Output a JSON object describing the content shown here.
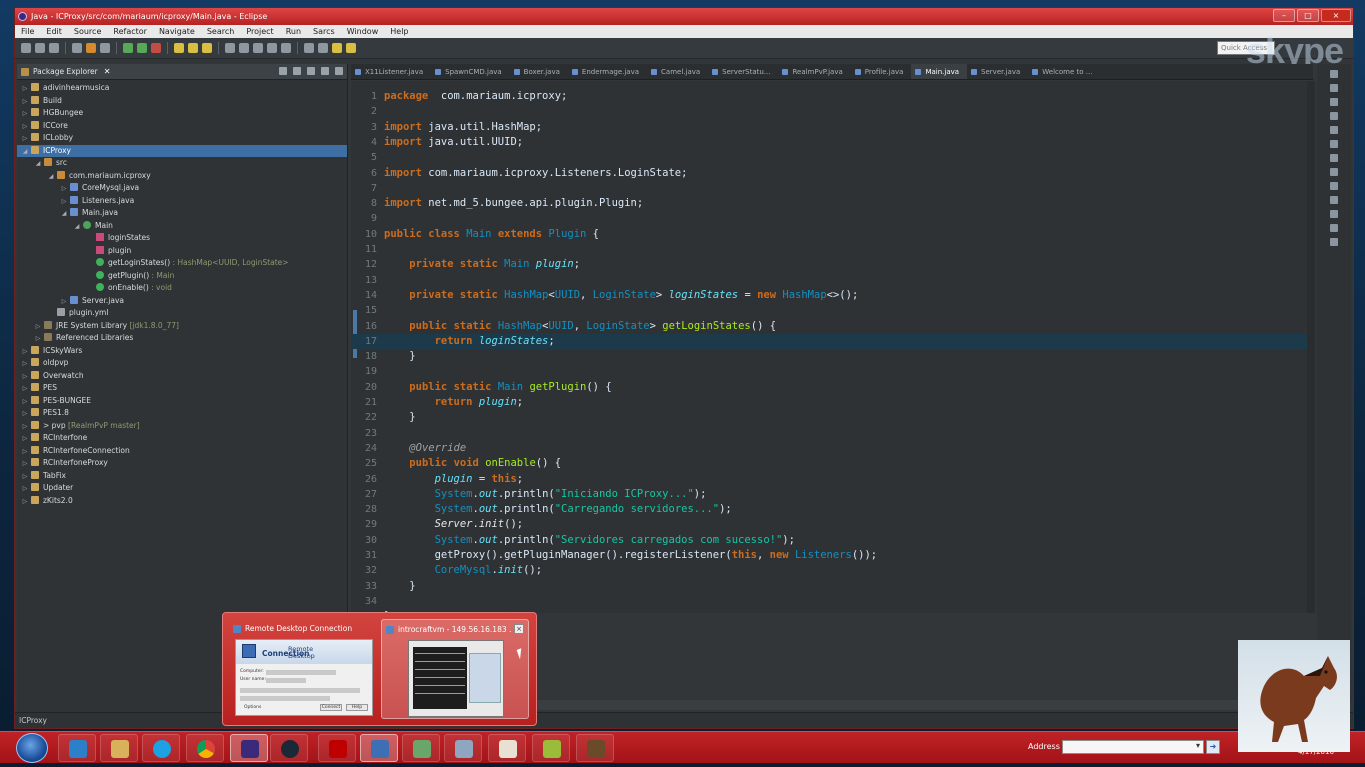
{
  "window": {
    "title": "Java - ICProxy/src/com/mariaum/icproxy/Main.java - Eclipse",
    "controls": [
      "–",
      "□",
      "×"
    ]
  },
  "menu": [
    "File",
    "Edit",
    "Source",
    "Refactor",
    "Navigate",
    "Search",
    "Project",
    "Run",
    "Sarcs",
    "Window",
    "Help"
  ],
  "quick_access": "Quick Access",
  "watermark": "skype",
  "package_explorer": {
    "title": "Package Explorer",
    "rows": [
      {
        "label": "adivinhearmusica",
        "depth": 0,
        "icon": "proj"
      },
      {
        "label": "Build",
        "depth": 0,
        "icon": "proj"
      },
      {
        "label": "HGBungee",
        "depth": 0,
        "icon": "proj"
      },
      {
        "label": "ICCore",
        "depth": 0,
        "icon": "proj"
      },
      {
        "label": "ICLobby",
        "depth": 0,
        "icon": "proj"
      },
      {
        "label": "ICProxy",
        "depth": 0,
        "icon": "proj",
        "selected": true,
        "open": true
      },
      {
        "label": "src",
        "depth": 1,
        "icon": "pkgi",
        "open": true
      },
      {
        "label": "com.mariaum.icproxy",
        "depth": 2,
        "icon": "pkgi",
        "open": true
      },
      {
        "label": "CoreMysql.java",
        "depth": 3,
        "icon": "java"
      },
      {
        "label": "Listeners.java",
        "depth": 3,
        "icon": "java"
      },
      {
        "label": "Main.java",
        "depth": 3,
        "icon": "java",
        "open": true
      },
      {
        "label": "Main",
        "depth": 4,
        "icon": "cls",
        "open": true
      },
      {
        "label": "loginStates",
        "depth": 5,
        "icon": "fld"
      },
      {
        "label": "plugin",
        "depth": 5,
        "icon": "fld"
      },
      {
        "label": "getLoginStates()",
        "suffix": " : HashMap<UUID, LoginState>",
        "depth": 5,
        "icon": "meth"
      },
      {
        "label": "getPlugin()",
        "suffix": " : Main",
        "depth": 5,
        "icon": "meth"
      },
      {
        "label": "onEnable()",
        "suffix": " : void",
        "depth": 5,
        "icon": "meth"
      },
      {
        "label": "Server.java",
        "depth": 3,
        "icon": "java"
      },
      {
        "label": "plugin.yml",
        "depth": 2,
        "icon": "yml"
      },
      {
        "label": "JRE System Library",
        "suffix": " [jdk1.8.0_77]",
        "depth": 1,
        "icon": "lib"
      },
      {
        "label": "Referenced Libraries",
        "depth": 1,
        "icon": "lib"
      },
      {
        "label": "ICSkyWars",
        "depth": 0,
        "icon": "proj"
      },
      {
        "label": "oldpvp",
        "depth": 0,
        "icon": "proj"
      },
      {
        "label": "Overwatch",
        "depth": 0,
        "icon": "proj"
      },
      {
        "label": "PES",
        "depth": 0,
        "icon": "proj"
      },
      {
        "label": "PES-BUNGEE",
        "depth": 0,
        "icon": "proj"
      },
      {
        "label": "PES1.8",
        "depth": 0,
        "icon": "proj"
      },
      {
        "label": "> pvp",
        "suffix": " [RealmPvP master]",
        "depth": 0,
        "icon": "proj"
      },
      {
        "label": "RCInterfone",
        "depth": 0,
        "icon": "proj"
      },
      {
        "label": "RCInterfoneConnection",
        "depth": 0,
        "icon": "proj"
      },
      {
        "label": "RCInterfoneProxy",
        "depth": 0,
        "icon": "proj"
      },
      {
        "label": "TabFix",
        "depth": 0,
        "icon": "proj"
      },
      {
        "label": "Updater",
        "depth": 0,
        "icon": "proj"
      },
      {
        "label": "zKits2.0",
        "depth": 0,
        "icon": "proj"
      }
    ]
  },
  "editor_tabs": [
    {
      "label": "X11Listener.java"
    },
    {
      "label": "SpawnCMD.java"
    },
    {
      "label": "Boxer.java"
    },
    {
      "label": "Endermage.java"
    },
    {
      "label": "Camel.java"
    },
    {
      "label": "ServerStatu..."
    },
    {
      "label": "RealmPvP.java"
    },
    {
      "label": "Profile.java"
    },
    {
      "label": "Main.java",
      "active": true
    },
    {
      "label": "Server.java"
    },
    {
      "label": "Welcome to ..."
    }
  ],
  "code_lines": [
    "1",
    "2",
    "3",
    "4",
    "5",
    "6",
    "7",
    "8",
    "9",
    "10",
    "11",
    "12",
    "13",
    "14",
    "15",
    "16",
    "17",
    "18",
    "19",
    "20",
    "21",
    "22",
    "23",
    "24",
    "25",
    "26",
    "27",
    "28",
    "29",
    "30",
    "31",
    "32",
    "33",
    "34",
    "35"
  ],
  "status": {
    "selection": "ICProxy"
  },
  "taskbar": {
    "address_label": "Address",
    "date": "4/17/2016"
  },
  "thumbnail_popup": {
    "items": [
      {
        "title": "Remote Desktop Connection",
        "preview_heading_1": "Remote Desktop",
        "preview_heading_2": "Connection",
        "preview_computer": "Computer:",
        "preview_user": "User name:",
        "preview_options": "Options",
        "preview_connect": "Connect",
        "preview_help": "Help"
      },
      {
        "title": "introcraftvm - 149.56.16.183 ...",
        "close": "×",
        "active": true
      }
    ]
  }
}
